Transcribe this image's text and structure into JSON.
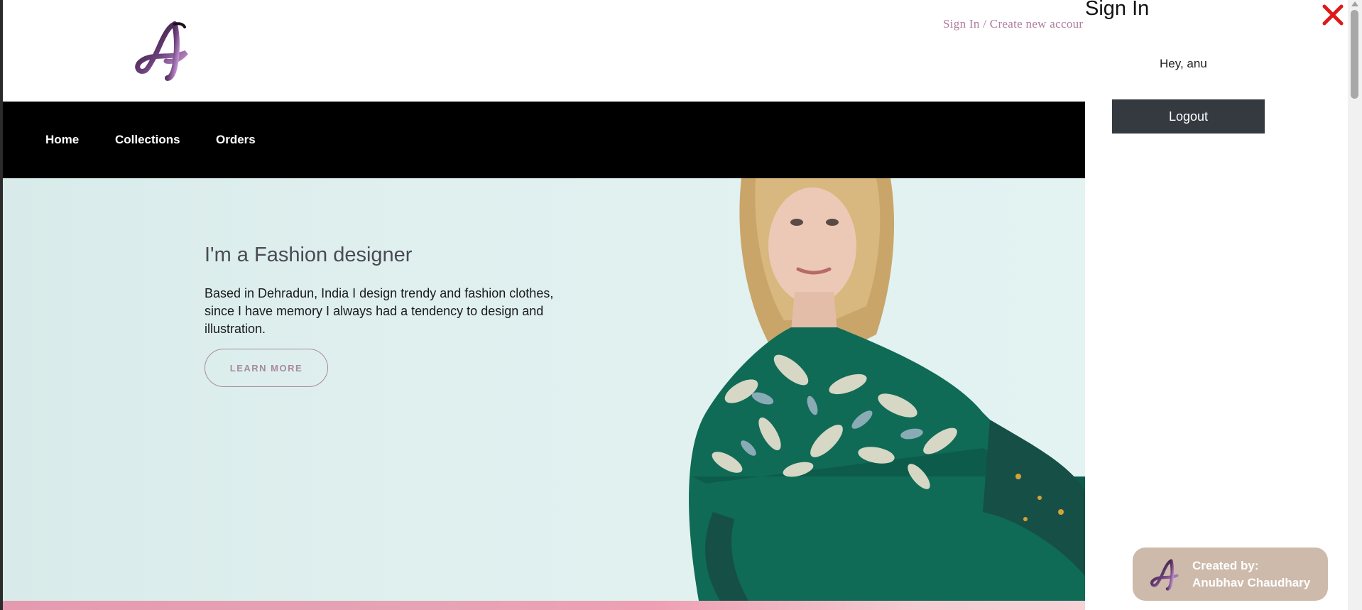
{
  "header": {
    "signin_link": "Sign In / Create new accour"
  },
  "nav": {
    "items": [
      "Home",
      "Collections",
      "Orders"
    ]
  },
  "hero": {
    "title": "I'm a Fashion designer",
    "text": "Based in Dehradun, India I design trendy and fashion clothes, since I have memory I always had a tendency to design and illustration.",
    "button": "LEARN MORE"
  },
  "panel": {
    "title": "Sign In",
    "greeting": "Hey, anu",
    "logout": "Logout",
    "close_icon": "close-x-icon"
  },
  "credit": {
    "line1": "Created by:",
    "line2": "Anubhav Chaudhary"
  },
  "colors": {
    "nav_bg": "#000000",
    "hero_bg": "#dbeeed",
    "accent_pink": "#b07a9e",
    "logout_bg": "#343a40",
    "close_red": "#e01818",
    "credit_bg": "#cdbaab"
  }
}
